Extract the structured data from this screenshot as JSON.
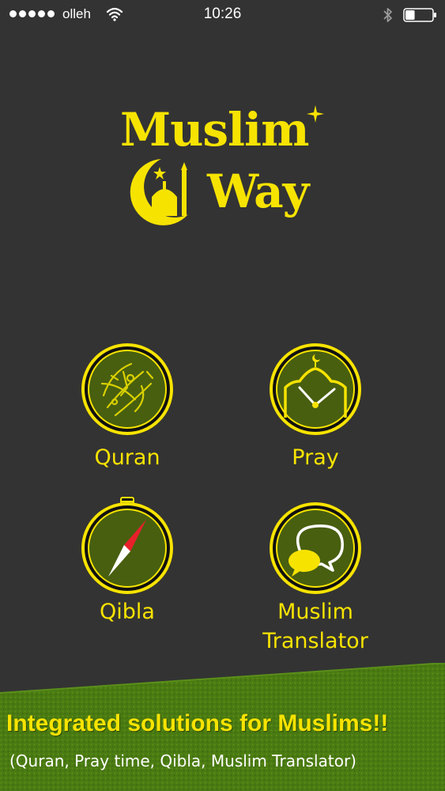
{
  "status_bar": {
    "carrier": "olleh",
    "time": "10:26",
    "signal_icon": "signal-dots-icon",
    "wifi_icon": "wifi-icon",
    "bluetooth_icon": "bluetooth-icon",
    "battery_icon": "battery-icon",
    "battery_level": 0.35
  },
  "logo": {
    "line1": "Muslim",
    "line2": "Way",
    "icon": "mosque-crescent-icon"
  },
  "menu": {
    "items": [
      {
        "label": "Quran",
        "icon": "quran-calligraphy-icon"
      },
      {
        "label": "Pray",
        "icon": "mosque-clock-icon"
      },
      {
        "label": "Qibla",
        "icon": "compass-icon"
      },
      {
        "label": "Muslim Translator",
        "icon": "speech-bubbles-icon"
      }
    ]
  },
  "banner": {
    "title": "Integrated solutions for Muslims!!",
    "subtitle": "(Quran, Pray time, Qibla, Muslim Translator)"
  },
  "colors": {
    "background": "#333333",
    "accent": "#f7e300",
    "icon_fill": "#485f10",
    "banner_green": "#4a7a12"
  }
}
